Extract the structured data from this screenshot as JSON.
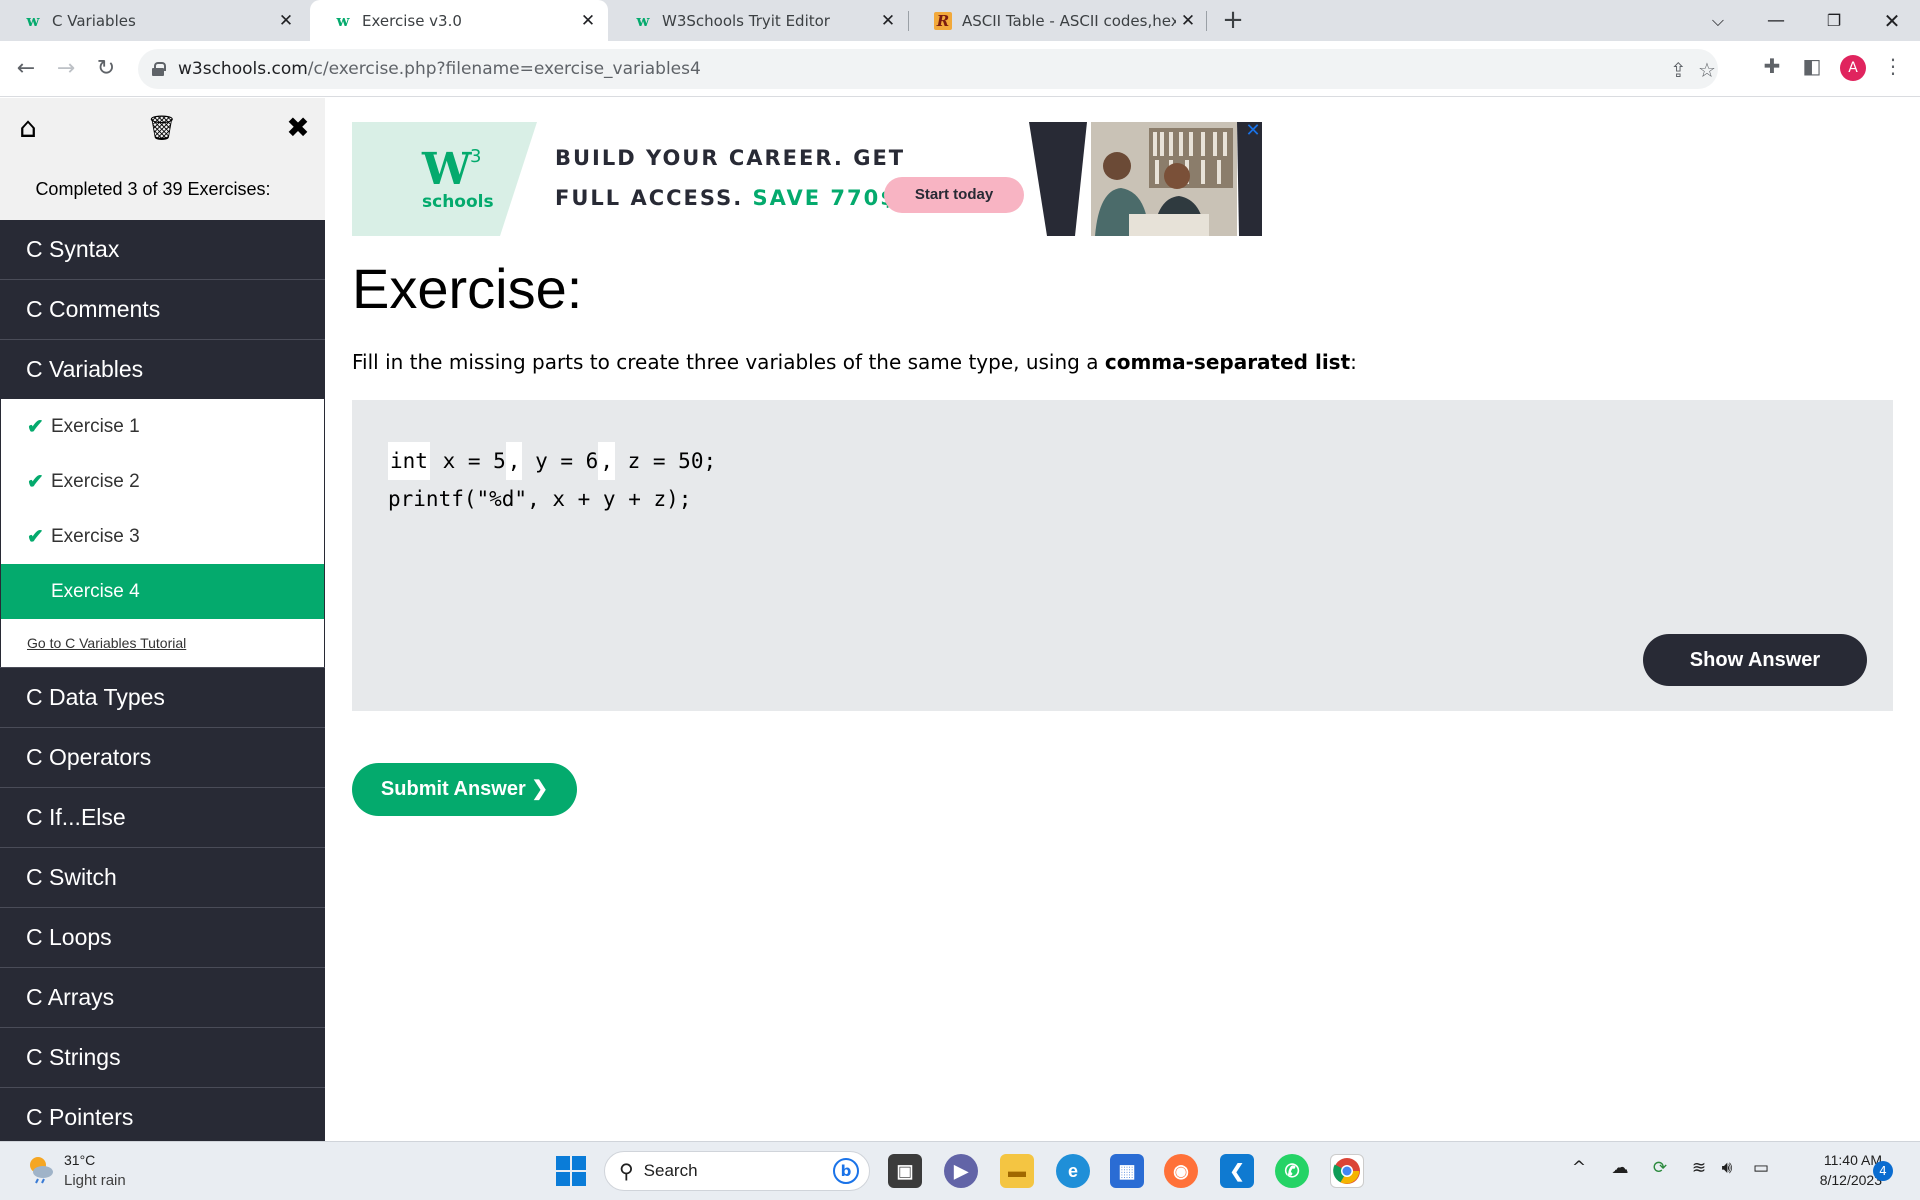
{
  "browser": {
    "tabs": [
      {
        "favicon": "w3schools-icon",
        "title": "C Variables",
        "active": false
      },
      {
        "favicon": "w3schools-icon",
        "title": "Exercise v3.0",
        "active": true
      },
      {
        "favicon": "w3schools-icon",
        "title": "W3Schools Tryit Editor",
        "active": false
      },
      {
        "favicon": "r-icon",
        "title": "ASCII Table - ASCII codes,hex,dec",
        "active": false
      }
    ],
    "url_host": "w3schools.com",
    "url_path": "/c/exercise.php?filename=exercise_variables4",
    "profile_initial": "A"
  },
  "sidebar": {
    "completed_text": "Completed 3 of 39 Exercises:",
    "categories_top": [
      "C Syntax",
      "C Comments",
      "C Variables"
    ],
    "sub_items": [
      {
        "label": "Exercise 1",
        "done": true
      },
      {
        "label": "Exercise 2",
        "done": true
      },
      {
        "label": "Exercise 3",
        "done": true
      },
      {
        "label": "Exercise 4",
        "done": false,
        "active": true
      }
    ],
    "tutorial_link": "Go to C Variables Tutorial",
    "categories_bottom": [
      "C Data Types",
      "C Operators",
      "C If...Else",
      "C Switch",
      "C Loops",
      "C Arrays",
      "C Strings",
      "C Pointers"
    ]
  },
  "ad": {
    "logo_text": "W",
    "logo_sup": "3",
    "logo_schools": "schools",
    "line1": "BUILD YOUR CAREER. GET",
    "line2_a": "FULL ACCESS.",
    "line2_b": "SAVE 770$",
    "cta": "Start today"
  },
  "exercise": {
    "title": "Exercise:",
    "desc_prefix": "Fill in the missing parts to create three variables of the same type, using a ",
    "desc_bold": "comma-separated list",
    "desc_suffix": ":",
    "code_line1": {
      "a": "int",
      "b": " x = 5",
      "c": ",",
      "d": " y = 6",
      "e": ",",
      "f": " z = 50;"
    },
    "code_line2": "printf(\"%d\", x + y + z);",
    "show_answer": "Show Answer",
    "submit": "Submit Answer ❯"
  },
  "taskbar": {
    "temp": "31°C",
    "weather": "Light rain",
    "search_label": "Search",
    "time": "11:40 AM",
    "date": "8/12/2023",
    "notification_count": "4"
  },
  "colors": {
    "w3_green": "#04aa6d",
    "sidebar_dark": "#282a35",
    "code_bg": "#e7e9eb"
  }
}
